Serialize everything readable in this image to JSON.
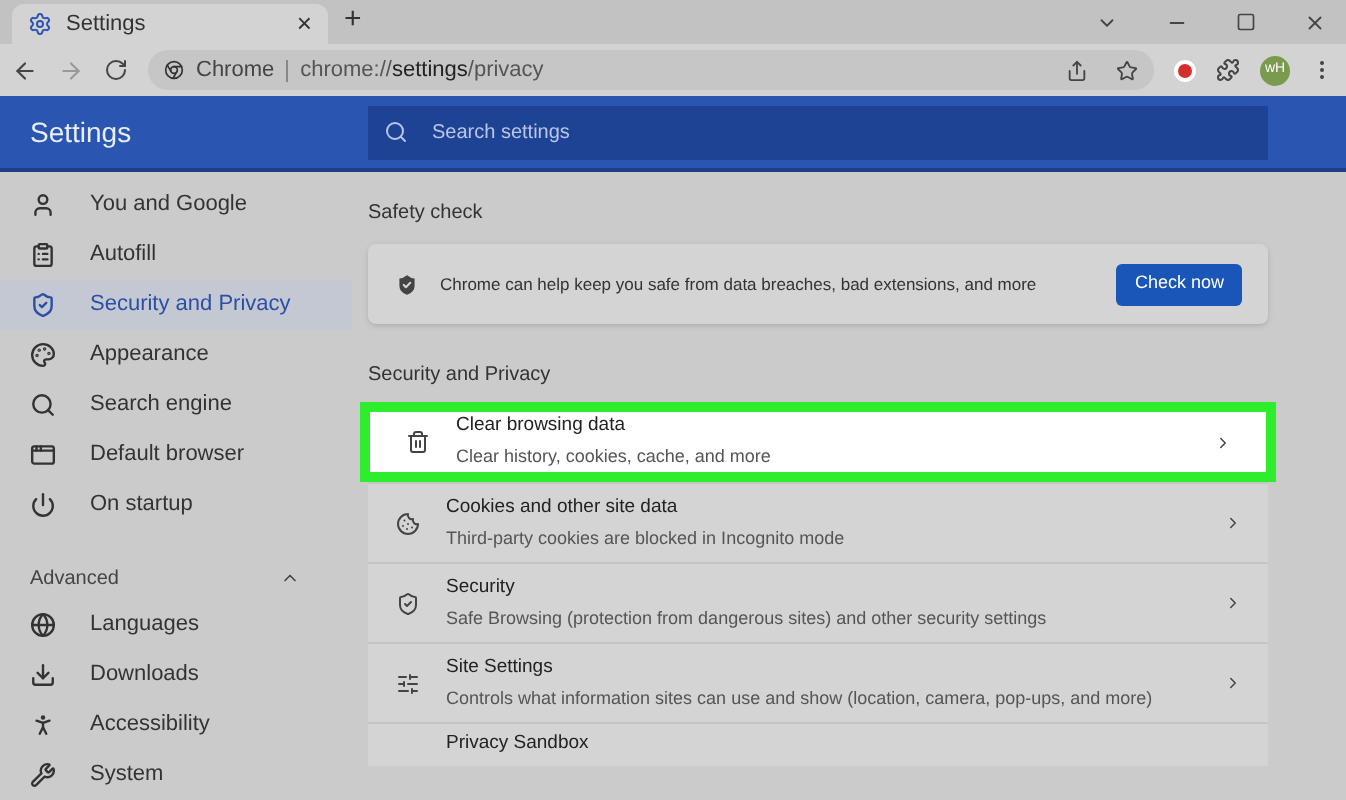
{
  "tab": {
    "title": "Settings",
    "close": "×",
    "new_tab": "+"
  },
  "toolbar": {
    "site_label": "Chrome",
    "url_host": "chrome://",
    "url_path": "settings",
    "url_rest": "/privacy",
    "profile": "wH"
  },
  "header": {
    "title": "Settings",
    "search": {
      "placeholder": "Search settings"
    }
  },
  "sidebar": {
    "items": [
      {
        "label": "You and Google",
        "selected": false
      },
      {
        "label": "Autofill",
        "selected": false
      },
      {
        "label": "Security and Privacy",
        "selected": true
      },
      {
        "label": "Appearance",
        "selected": false
      },
      {
        "label": "Search engine",
        "selected": false
      },
      {
        "label": "Default browser",
        "selected": false
      },
      {
        "label": "On startup",
        "selected": false
      }
    ],
    "advanced": {
      "label": "Advanced",
      "expanded": true
    },
    "advanced_items": [
      {
        "label": "Languages",
        "selected": false
      },
      {
        "label": "Downloads",
        "selected": false
      },
      {
        "label": "Accessibility",
        "selected": false
      },
      {
        "label": "System",
        "selected": false
      }
    ]
  },
  "safety_check": {
    "heading": "Safety check",
    "text": "Chrome can help keep you safe from data breaches, bad extensions, and more",
    "button": "Check now"
  },
  "privacy": {
    "heading": "Security and Privacy",
    "rows": [
      {
        "title": "Clear browsing data",
        "subtitle": "Clear history, cookies, cache, and more",
        "highlighted": true
      },
      {
        "title": "Cookies and other site data",
        "subtitle": "Third-party cookies are blocked in Incognito mode",
        "highlighted": false
      },
      {
        "title": "Security",
        "subtitle": "Safe Browsing (protection from dangerous sites) and other security settings",
        "highlighted": false
      },
      {
        "title": "Site Settings",
        "subtitle": "Controls what information sites can use and show (location, camera, pop-ups, and more)",
        "highlighted": false
      },
      {
        "title": "Privacy Sandbox",
        "highlighted": false
      }
    ]
  }
}
